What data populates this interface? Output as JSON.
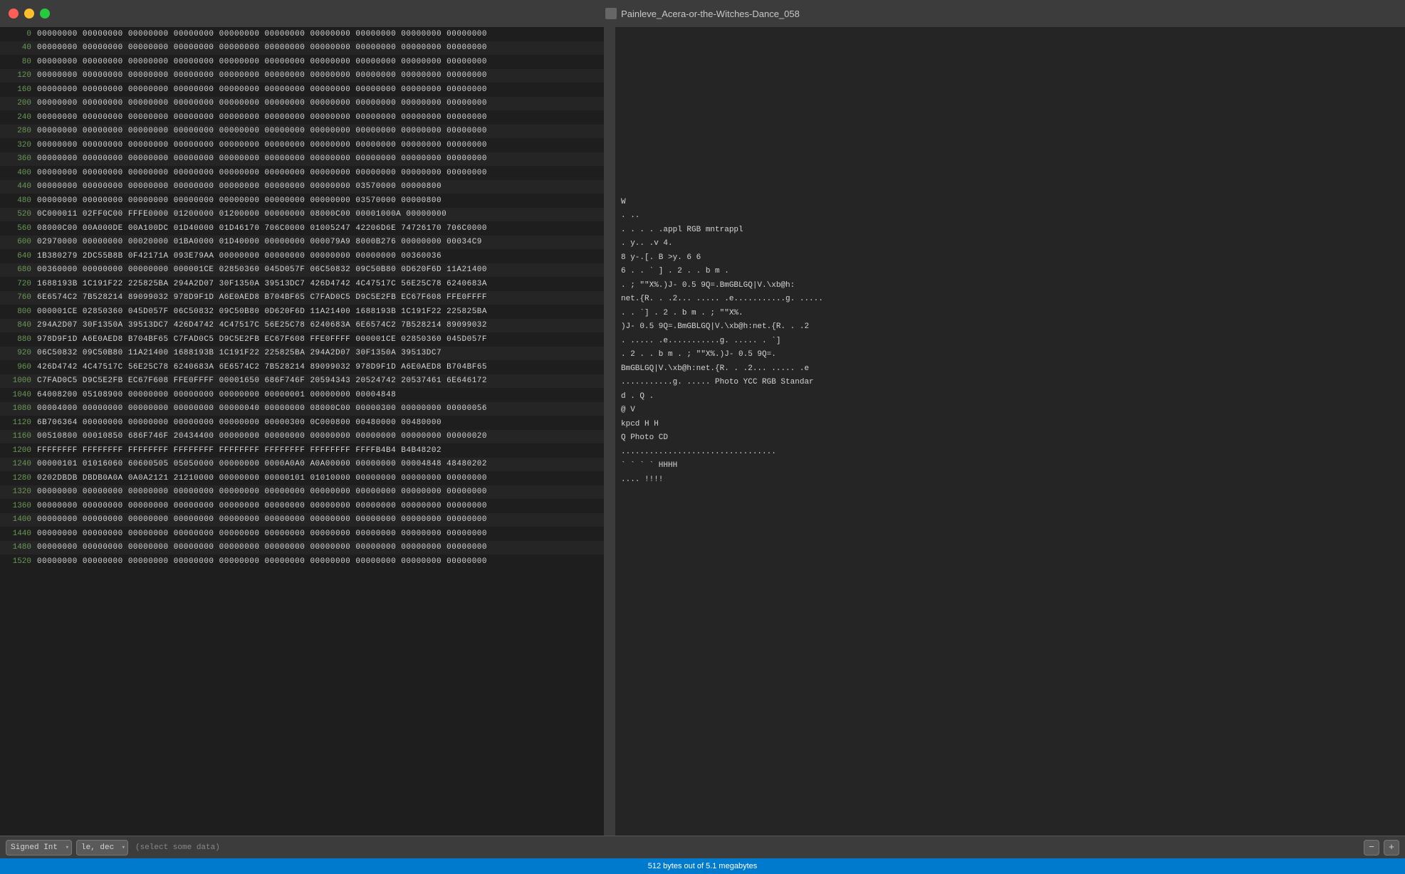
{
  "titleBar": {
    "title": "Painleve_Acera-or-the-Witches-Dance_058",
    "trafficLights": [
      "close",
      "minimize",
      "maximize"
    ]
  },
  "hexEditor": {
    "rows": [
      {
        "offset": "0",
        "bytes": "00000000  00000000  00000000  00000000  00000000  00000000  00000000  00000000  00000000  00000000"
      },
      {
        "offset": "40",
        "bytes": "00000000  00000000  00000000  00000000  00000000  00000000  00000000  00000000  00000000  00000000"
      },
      {
        "offset": "80",
        "bytes": "00000000  00000000  00000000  00000000  00000000  00000000  00000000  00000000  00000000  00000000"
      },
      {
        "offset": "120",
        "bytes": "00000000  00000000  00000000  00000000  00000000  00000000  00000000  00000000  00000000  00000000"
      },
      {
        "offset": "160",
        "bytes": "00000000  00000000  00000000  00000000  00000000  00000000  00000000  00000000  00000000  00000000"
      },
      {
        "offset": "200",
        "bytes": "00000000  00000000  00000000  00000000  00000000  00000000  00000000  00000000  00000000  00000000"
      },
      {
        "offset": "240",
        "bytes": "00000000  00000000  00000000  00000000  00000000  00000000  00000000  00000000  00000000  00000000"
      },
      {
        "offset": "280",
        "bytes": "00000000  00000000  00000000  00000000  00000000  00000000  00000000  00000000  00000000  00000000"
      },
      {
        "offset": "320",
        "bytes": "00000000  00000000  00000000  00000000  00000000  00000000  00000000  00000000  00000000  00000000"
      },
      {
        "offset": "360",
        "bytes": "00000000  00000000  00000000  00000000  00000000  00000000  00000000  00000000  00000000  00000000"
      },
      {
        "offset": "400",
        "bytes": "00000000  00000000  00000000  00000000  00000000  00000000  00000000  00000000  00000000  00000000"
      },
      {
        "offset": "440",
        "bytes": "00000000  00000000  00000000  00000000  00000000  00000000  00000000  03570000  00000800"
      },
      {
        "offset": "480",
        "bytes": "00000000  00000000  00000000  00000000  00000000  00000000  00000000  03570000  00000800"
      },
      {
        "offset": "520",
        "bytes": "0C000011  02FF0C00  FFFE0000  01200000  01200000  00000000  08000C00  00001000A  00000000"
      },
      {
        "offset": "560",
        "bytes": "08000C00  00A000DE  00A100DC  01D40000  01D46170  706C0000  01005247  42206D6E  74726170  706C0000"
      },
      {
        "offset": "600",
        "bytes": "02970000  00000000  00020000  01BA0000  01D40000  00000000  000079A9  8000B276  00000000  00034C9"
      },
      {
        "offset": "640",
        "bytes": "1B380279  2DC55B8B  0F42171A  093E79AA  00000000  00000000  00000000  00000000  00360036"
      },
      {
        "offset": "680",
        "bytes": "00360000  00000000  00000000  000001CE  02850360  045D057F  06C50832  09C50B80  0D620F6D  11A21400"
      },
      {
        "offset": "720",
        "bytes": "1688193B  1C191F22  225825BA  294A2D07  30F1350A  39513DC7  426D4742  4C47517C  56E25C78  6240683A"
      },
      {
        "offset": "760",
        "bytes": "6E6574C2  7B528214  89099032  978D9F1D  A6E0AED8  B704BF65  C7FAD0C5  D9C5E2FB  EC67F608  FFE0FFFF"
      },
      {
        "offset": "800",
        "bytes": "000001CE  02850360  045D057F  06C50832  09C50B80  0D620F6D  11A21400  1688193B  1C191F22  225825BA"
      },
      {
        "offset": "840",
        "bytes": "294A2D07  30F1350A  39513DC7  426D4742  4C47517C  56E25C78  6240683A  6E6574C2  7B528214  89099032"
      },
      {
        "offset": "880",
        "bytes": "978D9F1D  A6E0AED8  B704BF65  C7FAD0C5  D9C5E2FB  EC67F608  FFE0FFFF  000001CE  02850360  045D057F"
      },
      {
        "offset": "920",
        "bytes": "06C50832  09C50B80  11A21400  1688193B  1C191F22  225825BA  294A2D07  30F1350A  39513DC7"
      },
      {
        "offset": "960",
        "bytes": "426D4742  4C47517C  56E25C78  6240683A  6E6574C2  7B528214  89099032  978D9F1D  A6E0AED8  B704BF65"
      },
      {
        "offset": "1000",
        "bytes": "C7FAD0C5  D9C5E2FB  EC67F608  FFE0FFFF  00001650  686F746F  20594343  20524742  20537461  6E646172"
      },
      {
        "offset": "1040",
        "bytes": "64008200  05108900  00000000  00000000  00000000  00000001  00000000  00004848"
      },
      {
        "offset": "1080",
        "bytes": "00004000  00000000  00000000  00000000  00000040  00000000  08000C00  00000300  00000000  00000056"
      },
      {
        "offset": "1120",
        "bytes": "6B706364  00000000  00000000  00000000  00000000  00000300  0C000800  00480000  00480000"
      },
      {
        "offset": "1160",
        "bytes": "00510800  00010850  686F746F  20434400  00000000  00000000  00000000  00000000  00000000  00000020"
      },
      {
        "offset": "1200",
        "bytes": "FFFFFFFF  FFFFFFFF  FFFFFFFF  FFFFFFFF  FFFFFFFF  FFFFFFFF  FFFFFFFF  FFFFB4B4  B4B48202"
      },
      {
        "offset": "1240",
        "bytes": "00000101  01016060  60600505  05050000  00000000  0000A0A0  A0A00000  00000000  00004848  48480202"
      },
      {
        "offset": "1280",
        "bytes": "0202DBDB  DBDB0A0A  0A0A2121  21210000  00000000  00000101  01010000  00000000  00000000  00000000"
      },
      {
        "offset": "1320",
        "bytes": "00000000  00000000  00000000  00000000  00000000  00000000  00000000  00000000  00000000  00000000"
      },
      {
        "offset": "1360",
        "bytes": "00000000  00000000  00000000  00000000  00000000  00000000  00000000  00000000  00000000  00000000"
      },
      {
        "offset": "1400",
        "bytes": "00000000  00000000  00000000  00000000  00000000  00000000  00000000  00000000  00000000  00000000"
      },
      {
        "offset": "1440",
        "bytes": "00000000  00000000  00000000  00000000  00000000  00000000  00000000  00000000  00000000  00000000"
      },
      {
        "offset": "1480",
        "bytes": "00000000  00000000  00000000  00000000  00000000  00000000  00000000  00000000  00000000  00000000"
      },
      {
        "offset": "1520",
        "bytes": "00000000  00000000  00000000  00000000  00000000  00000000  00000000  00000000  00000000  00000000"
      }
    ]
  },
  "asciiPanel": {
    "rows": [
      "",
      "",
      "",
      "",
      "",
      "",
      "",
      "",
      "",
      "",
      "",
      "",
      "                                W",
      "          .   ..                                                ",
      "          .   .   .   .     .appl     RGB mntrappl",
      "                        .                      y.. .v          4.",
      "          8 y-.[. B   >y.                      6 6",
      "          6           . . ` ]   . 2 . . b m .",
      "          . ;    \"\"X%.)J-  0.5  9Q=.BmGBLGQ|V.\\xb@h:",
      "          net.{R.  . .2...  ..... .e...........g.  .....",
      "          . . `]  . 2 . b m .   ;   \"\"X%.",
      "          )J- 0.5 9Q=.BmGBLGQ|V.\\xb@h:net.{R. . .2",
      "          . ..... .e...........g.  .....   . `]",
      "          . 2 . . b m .   ;   \"\"X%.)J- 0.5 9Q=.",
      "          BmGBLGQ|V.\\xb@h:net.{R.  . .2...  ..... .e",
      "          ...........g.  .....   Photo YCC RGB Standar",
      "          d .  Q .",
      "          @                        V",
      "          kpcd                     H    H",
      "          Q      Photo CD",
      "          .................................",
      "          ` ` ` `                        HHHH",
      "          ....      !!!!",
      "",
      "",
      "",
      "",
      "",
      ""
    ]
  },
  "toolbar": {
    "typeLabel": "Signed Int",
    "formatLabel": "le, dec",
    "hintText": "(select some data)",
    "decrementLabel": "−",
    "incrementLabel": "+"
  },
  "statusBar": {
    "text": "512 bytes out of 5.1 megabytes"
  }
}
